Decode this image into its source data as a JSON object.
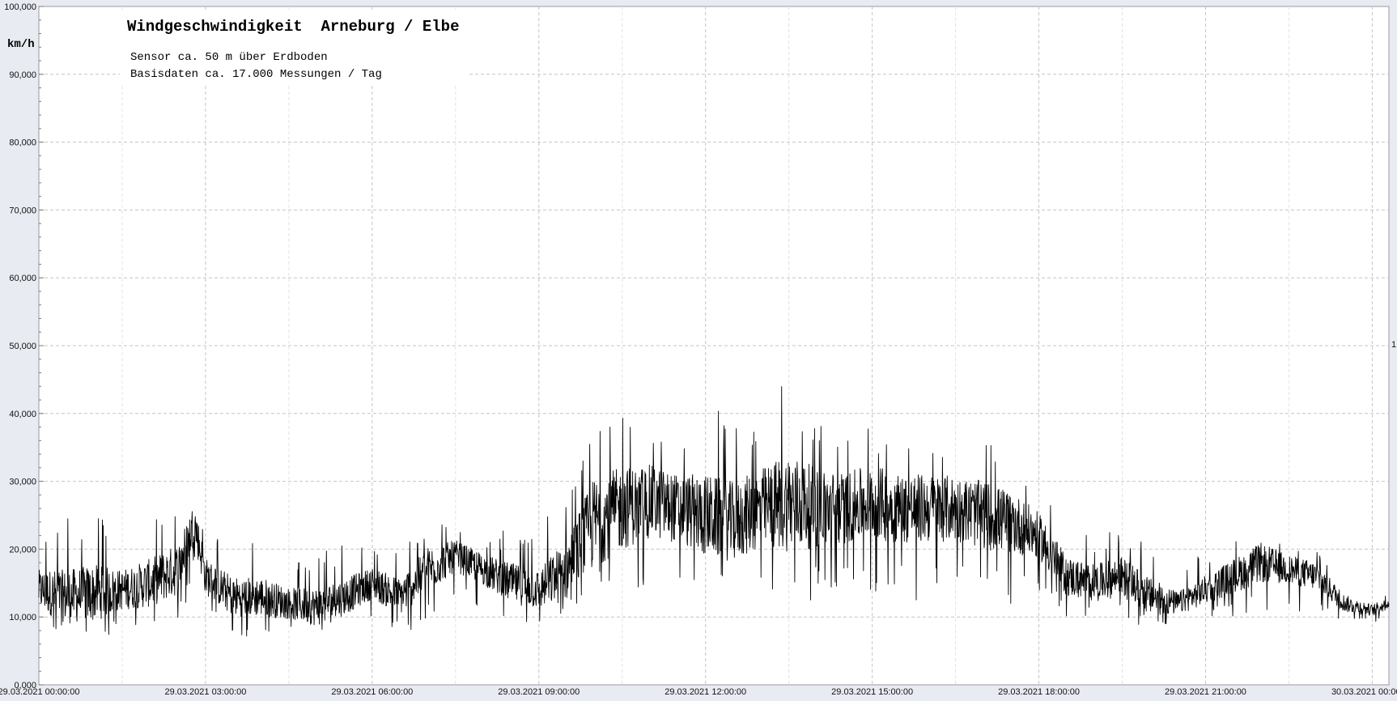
{
  "chart_data": {
    "type": "line",
    "title": "Windgeschwindigkeit  Arneburg / Elbe",
    "subtitle_lines": [
      "Sensor ca. 50 m über Erdboden",
      "Basisdaten ca. 17.000 Messungen / Tag"
    ],
    "ylabel": "km/h",
    "xlabel": "",
    "ylim": [
      0,
      100
    ],
    "y_ticks": [
      "0,000",
      "10,000",
      "20,000",
      "30,000",
      "40,000",
      "50,000",
      "60,000",
      "70,000",
      "80,000",
      "90,000",
      "100,000"
    ],
    "x_ticks": [
      {
        "hour": 0,
        "label": "29.03.2021  00:00:00"
      },
      {
        "hour": 3,
        "label": "29.03.2021  03:00:00"
      },
      {
        "hour": 6,
        "label": "29.03.2021  06:00:00"
      },
      {
        "hour": 9,
        "label": "29.03.2021  09:00:00"
      },
      {
        "hour": 12,
        "label": "29.03.2021  12:00:00"
      },
      {
        "hour": 15,
        "label": "29.03.2021  15:00:00"
      },
      {
        "hour": 18,
        "label": "29.03.2021  18:00:00"
      },
      {
        "hour": 21,
        "label": "29.03.2021  21:00:00"
      },
      {
        "hour": 24,
        "label": "30.03.2021  00:00:00"
      }
    ],
    "xlim_hours": [
      0,
      24.3
    ],
    "grid": true,
    "right_edge_label": "1",
    "series": [
      {
        "envelope_hourly": {
          "hours": [
            0,
            0.5,
            1,
            1.5,
            2,
            2.5,
            2.8,
            3,
            3.5,
            4,
            4.5,
            5,
            5.5,
            6,
            6.5,
            7,
            7.5,
            8,
            8.5,
            9,
            9.5,
            10,
            10.5,
            11,
            11.5,
            12,
            12.5,
            13,
            13.5,
            14,
            14.5,
            15,
            15.5,
            16,
            16.5,
            17,
            17.5,
            18,
            18.5,
            19,
            19.5,
            20,
            20.5,
            21,
            21.5,
            22,
            22.5,
            23,
            23.5,
            24,
            24.3
          ],
          "mean": [
            14,
            13,
            13.5,
            14,
            15,
            17,
            24,
            16,
            13,
            13,
            12,
            11.5,
            13,
            15,
            13,
            17,
            19,
            17,
            15,
            14,
            17,
            24,
            26,
            27,
            26,
            25,
            24,
            26,
            27,
            26,
            26,
            27,
            26,
            26,
            26,
            25,
            24,
            22,
            16,
            15,
            16,
            13,
            12,
            14,
            16,
            18,
            17,
            16,
            12,
            11,
            12
          ],
          "max": [
            22,
            26,
            27,
            21,
            24,
            26,
            31,
            22,
            21,
            21,
            18,
            20,
            21,
            20,
            20,
            25,
            23,
            22,
            23,
            23,
            32,
            44,
            43,
            40,
            38,
            43,
            40,
            40,
            46,
            40,
            38,
            38,
            37,
            36,
            35,
            36,
            34,
            30,
            24,
            22,
            24,
            21,
            16,
            20,
            22,
            25,
            21,
            20,
            15,
            13,
            14
          ],
          "min": [
            8,
            7,
            7,
            7,
            7,
            8,
            16,
            9,
            7,
            7,
            7,
            6.5,
            8,
            9,
            7,
            9,
            12,
            11,
            9,
            9,
            10,
            12,
            14,
            14,
            14,
            14,
            12,
            12,
            11,
            12,
            13,
            12,
            12,
            12,
            12,
            12,
            12,
            14,
            10,
            9,
            10,
            8,
            8,
            10,
            10,
            11,
            11,
            10,
            9,
            9,
            10
          ]
        }
      }
    ]
  }
}
